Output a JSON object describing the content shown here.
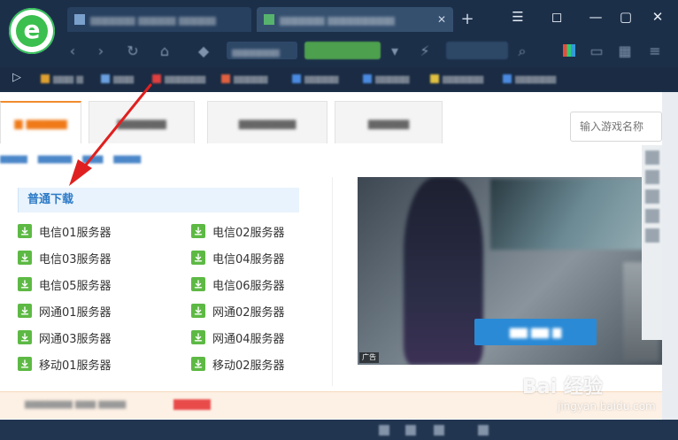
{
  "browser": {
    "window_controls": [
      "☰",
      "◻",
      "—",
      "▢",
      "✕"
    ]
  },
  "page": {
    "game_search": {
      "placeholder": "输入游戏名称"
    },
    "download_section": {
      "header": "普通下载",
      "servers": [
        "电信01服务器",
        "电信02服务器",
        "电信03服务器",
        "电信04服务器",
        "电信05服务器",
        "电信06服务器",
        "网通01服务器",
        "网通02服务器",
        "网通03服务器",
        "网通04服务器",
        "移动01服务器",
        "移动02服务器"
      ]
    },
    "ad": {
      "tag": "广告"
    }
  },
  "watermark": {
    "main": "Bai 经验",
    "sub": "jingyan.baidu.com"
  },
  "colors": {
    "accent_orange": "#f07a18",
    "download_green": "#5db944",
    "link_blue": "#2c7ac6",
    "arrow_red": "#e02020"
  }
}
